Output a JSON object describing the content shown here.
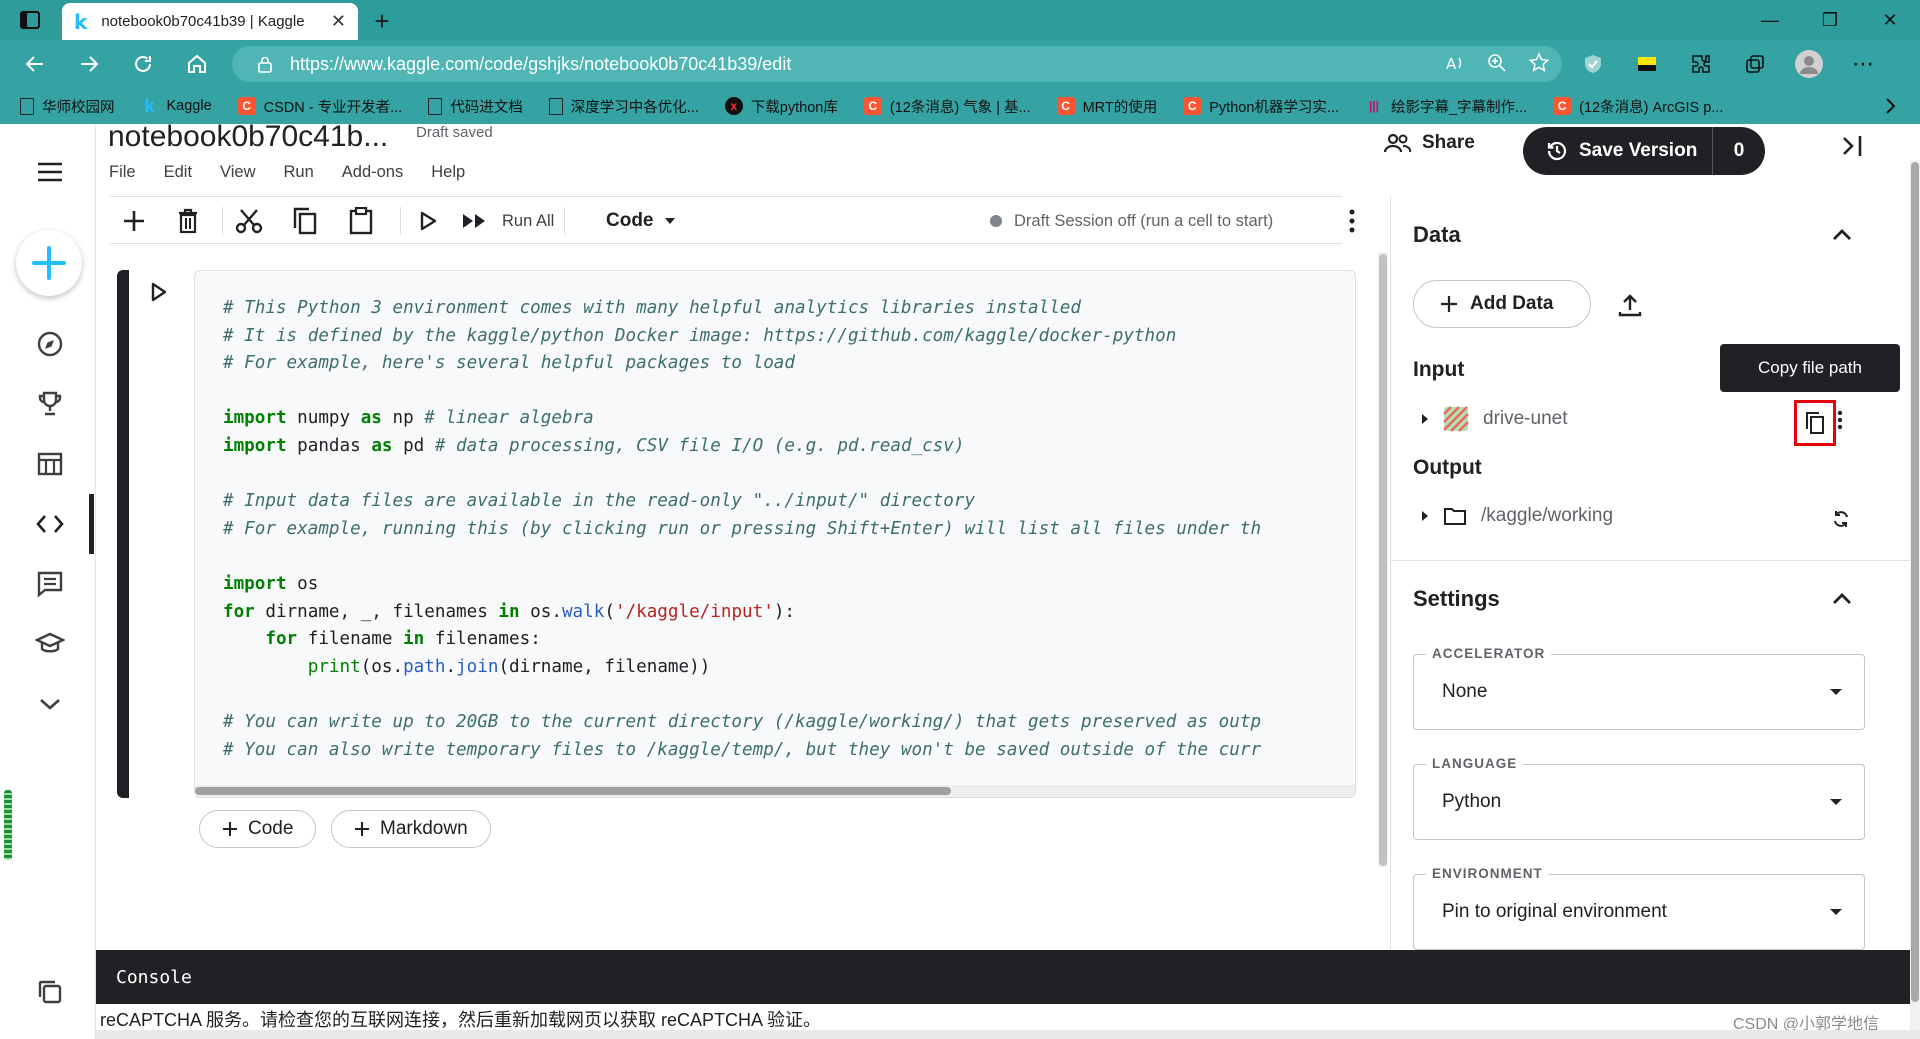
{
  "browser": {
    "tab_title": "notebook0b70c41b39 | Kaggle",
    "url": "https://www.kaggle.com/code/gshjks/notebook0b70c41b39/edit",
    "bookmarks": [
      {
        "icon": "doc",
        "label": "华师校园网"
      },
      {
        "icon": "kaggle",
        "label": "Kaggle"
      },
      {
        "icon": "csdn",
        "label": "CSDN - 专业开发者..."
      },
      {
        "icon": "doc",
        "label": "代码进文档"
      },
      {
        "icon": "doc",
        "label": "深度学习中各优化..."
      },
      {
        "icon": "x",
        "label": "下载python库"
      },
      {
        "icon": "csdn",
        "label": "(12条消息) 气象 | 基..."
      },
      {
        "icon": "csdn",
        "label": "MRT的使用"
      },
      {
        "icon": "csdn",
        "label": "Python机器学习实..."
      },
      {
        "icon": "wave",
        "label": "绘影字幕_字幕制作..."
      },
      {
        "icon": "csdn",
        "label": "(12条消息) ArcGIS p..."
      }
    ]
  },
  "notebook": {
    "title": "notebook0b70c41b...",
    "draft_status": "Draft saved",
    "menu": [
      "File",
      "Edit",
      "View",
      "Run",
      "Add-ons",
      "Help"
    ],
    "share_label": "Share",
    "save_version_label": "Save Version",
    "save_version_count": "0"
  },
  "toolbar": {
    "run_all_label": "Run All",
    "cell_type": "Code",
    "session_status": "Draft Session off (run a cell to start)"
  },
  "cell": {
    "code_lines": [
      "# This Python 3 environment comes with many helpful analytics libraries installed",
      "# It is defined by the kaggle/python Docker image: https://github.com/kaggle/docker-python",
      "# For example, here's several helpful packages to load",
      "",
      "import numpy as np # linear algebra",
      "import pandas as pd # data processing, CSV file I/O (e.g. pd.read_csv)",
      "",
      "# Input data files are available in the read-only \"../input/\" directory",
      "# For example, running this (by clicking run or pressing Shift+Enter) will list all files under th",
      "",
      "import os",
      "for dirname, _, filenames in os.walk('/kaggle/input'):",
      "    for filename in filenames:",
      "        print(os.path.join(dirname, filename))",
      "",
      "# You can write up to 20GB to the current directory (/kaggle/working/) that gets preserved as outp",
      "# You can also write temporary files to /kaggle/temp/, but they won't be saved outside of the curr"
    ],
    "add_code_label": "Code",
    "add_markdown_label": "Markdown"
  },
  "panel": {
    "data_title": "Data",
    "add_data_label": "Add Data",
    "input_title": "Input",
    "input_item": "drive-unet",
    "tooltip": "Copy file path",
    "output_title": "Output",
    "output_item": "/kaggle/working",
    "settings_title": "Settings",
    "accelerator": {
      "label": "ACCELERATOR",
      "value": "None"
    },
    "language": {
      "label": "LANGUAGE",
      "value": "Python"
    },
    "environment": {
      "label": "ENVIRONMENT",
      "value": "Pin to original environment"
    }
  },
  "console": {
    "title": "Console",
    "message": "reCAPTCHA 服务。请检查您的互联网连接，然后重新加载网页以获取 reCAPTCHA 验证。"
  },
  "watermark": "CSDN @小郭学地信",
  "colors": {
    "browser_chrome": "#35a3a3",
    "kaggle_blue": "#20beff",
    "dark": "#202124",
    "highlight_red": "#e8000b"
  }
}
